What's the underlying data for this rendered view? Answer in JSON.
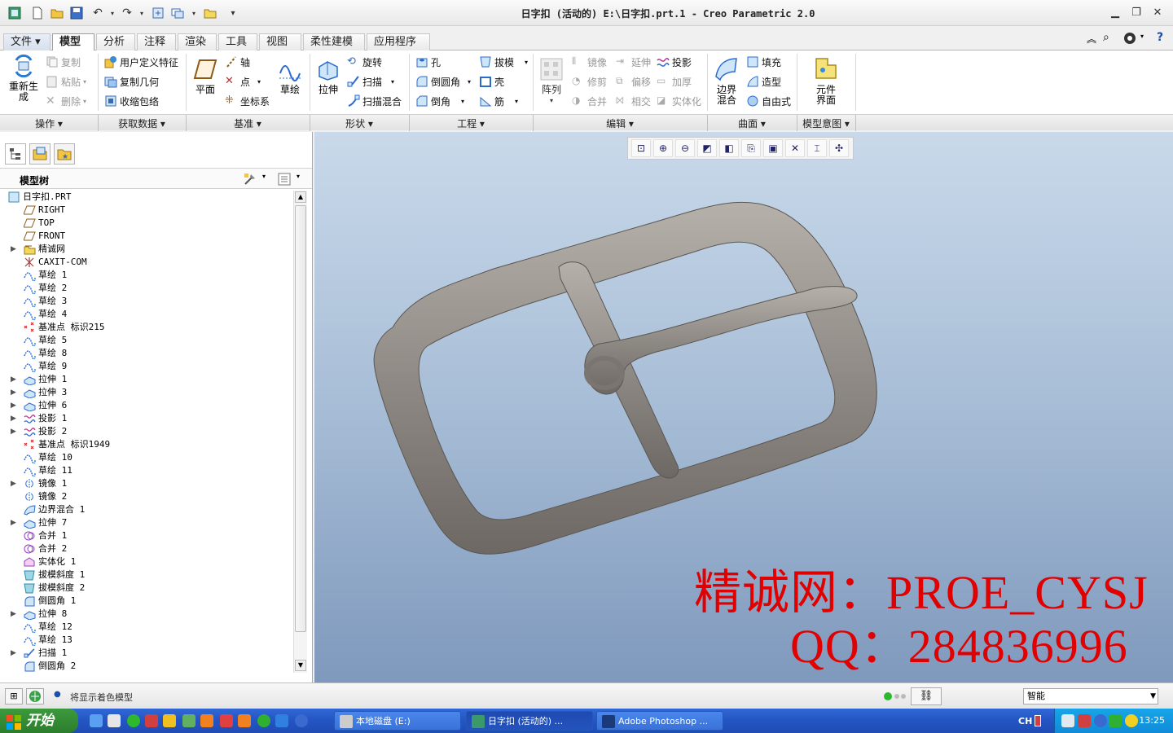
{
  "window": {
    "title": "日字扣 (活动的) E:\\日字扣.prt.1 - Creo Parametric 2.0"
  },
  "ribbon_tabs": [
    "文件 ▾",
    "模型",
    "分析",
    "注释",
    "渲染",
    "工具",
    "视图",
    "柔性建模",
    "应用程序"
  ],
  "ribbon": {
    "operations": {
      "regen": "重新生成",
      "copy": "复制",
      "paste": "粘贴",
      "delete": "删除"
    },
    "get_data": {
      "udf": "用户定义特征",
      "copy_geom": "复制几何",
      "shrinkwrap": "收缩包络"
    },
    "datum": {
      "plane": "平面",
      "axis": "轴",
      "point": "点",
      "csys": "坐标系",
      "sketch": "草绘"
    },
    "shape": {
      "extrude": "拉伸",
      "revolve": "旋转",
      "sweep": "扫描",
      "swept_blend": "扫描混合"
    },
    "engineering": {
      "hole": "孔",
      "round": "倒圆角",
      "chamfer": "倒角",
      "draft": "拔模",
      "shell": "壳",
      "rib": "筋"
    },
    "editing": {
      "pattern": "阵列",
      "mirror": "镜像",
      "trim": "修剪",
      "merge": "合并",
      "extend": "延伸",
      "offset": "偏移",
      "intersect": "相交",
      "project": "投影",
      "thicken": "加厚",
      "solidify": "实体化"
    },
    "surfaces": {
      "boundary_blend": "边界混合",
      "fill": "填充",
      "style": "造型",
      "freestyle": "自由式"
    },
    "model_intent": {
      "component_interface": "元件界面"
    },
    "groups": [
      "操作 ▾",
      "获取数据 ▾",
      "基准 ▾",
      "形状 ▾",
      "工程 ▾",
      "编辑 ▾",
      "曲面 ▾",
      "模型意图 ▾"
    ]
  },
  "model_tree": {
    "title": "模型树",
    "items": [
      {
        "label": "日字扣.PRT",
        "icon": "part-icon",
        "expand": false
      },
      {
        "label": "RIGHT",
        "icon": "datum-plane-icon",
        "expand": false
      },
      {
        "label": "TOP",
        "icon": "datum-plane-icon",
        "expand": false
      },
      {
        "label": "FRONT",
        "icon": "datum-plane-icon",
        "expand": false
      },
      {
        "label": "精诚网",
        "icon": "layer-icon",
        "expand": true
      },
      {
        "label": "CAXIT-COM",
        "icon": "csys-icon",
        "expand": false
      },
      {
        "label": "草绘 1",
        "icon": "sketch-icon",
        "expand": false
      },
      {
        "label": "草绘 2",
        "icon": "sketch-icon",
        "expand": false
      },
      {
        "label": "草绘 3",
        "icon": "sketch-icon",
        "expand": false
      },
      {
        "label": "草绘 4",
        "icon": "sketch-icon",
        "expand": false
      },
      {
        "label": "基准点 标识215",
        "icon": "datum-point-icon",
        "expand": false
      },
      {
        "label": "草绘 5",
        "icon": "sketch-icon",
        "expand": false
      },
      {
        "label": "草绘 8",
        "icon": "sketch-icon",
        "expand": false
      },
      {
        "label": "草绘 9",
        "icon": "sketch-icon",
        "expand": false
      },
      {
        "label": "拉伸 1",
        "icon": "extrude-icon",
        "expand": true
      },
      {
        "label": "拉伸 3",
        "icon": "extrude-icon",
        "expand": true
      },
      {
        "label": "拉伸 6",
        "icon": "extrude-icon",
        "expand": true
      },
      {
        "label": "投影 1",
        "icon": "project-icon",
        "expand": true
      },
      {
        "label": "投影 2",
        "icon": "project-icon",
        "expand": true
      },
      {
        "label": "基准点 标识1949",
        "icon": "datum-point-icon",
        "expand": false
      },
      {
        "label": "草绘 10",
        "icon": "sketch-icon",
        "expand": false
      },
      {
        "label": "草绘 11",
        "icon": "sketch-icon",
        "expand": false
      },
      {
        "label": "镜像 1",
        "icon": "mirror-icon",
        "expand": true
      },
      {
        "label": "镜像 2",
        "icon": "mirror-icon",
        "expand": false
      },
      {
        "label": "边界混合 1",
        "icon": "boundary-blend-icon",
        "expand": false
      },
      {
        "label": "拉伸 7",
        "icon": "extrude-icon",
        "expand": true
      },
      {
        "label": "合并 1",
        "icon": "merge-icon",
        "expand": false
      },
      {
        "label": "合并 2",
        "icon": "merge-icon",
        "expand": false
      },
      {
        "label": "实体化 1",
        "icon": "solidify-icon",
        "expand": false
      },
      {
        "label": "拔模斜度 1",
        "icon": "draft-icon",
        "expand": false
      },
      {
        "label": "拔模斜度 2",
        "icon": "draft-icon",
        "expand": false
      },
      {
        "label": "倒圆角 1",
        "icon": "round-icon",
        "expand": false
      },
      {
        "label": "拉伸 8",
        "icon": "extrude-icon",
        "expand": true
      },
      {
        "label": "草绘 12",
        "icon": "sketch-icon",
        "expand": false
      },
      {
        "label": "草绘 13",
        "icon": "sketch-icon",
        "expand": false
      },
      {
        "label": "扫描 1",
        "icon": "sweep-icon",
        "expand": true
      },
      {
        "label": "倒圆角 2",
        "icon": "round-icon",
        "expand": false
      }
    ]
  },
  "viewport": {
    "watermark_line1": "精诚网：PROE_CYSJ",
    "watermark_line2": "QQ：284836996"
  },
  "status": {
    "message": "将显示着色模型",
    "filter_value": "智能"
  },
  "taskbar": {
    "start": "开始",
    "items": [
      {
        "label": "本地磁盘 (E:)",
        "icon": "drive-icon"
      },
      {
        "label": "日字扣 (活动的) ...",
        "icon": "creo-icon"
      },
      {
        "label": "Adobe Photoshop ...",
        "icon": "photoshop-icon"
      }
    ],
    "lang": "CH",
    "clock": "13:25"
  },
  "colors": {
    "model_fill": "#8f8a85",
    "watermark": "#e00000",
    "viewport_top": "#c9d9ea",
    "viewport_bottom": "#7f99bd",
    "taskbar": "#2456c4"
  }
}
